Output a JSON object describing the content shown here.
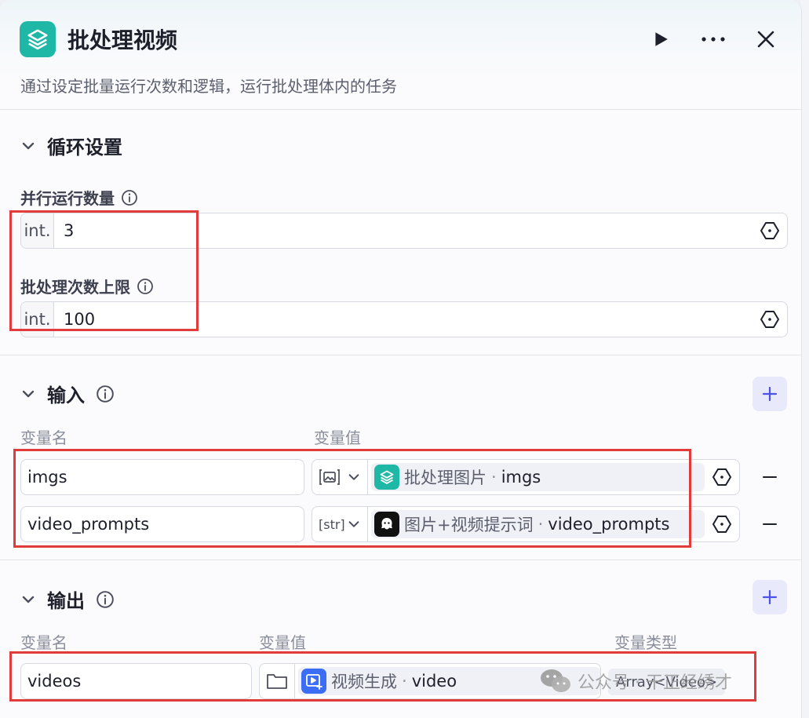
{
  "header": {
    "title": "批处理视频",
    "description": "通过设定批量运行次数和逻辑，运行批处理体内的任务"
  },
  "loop": {
    "section_title": "循环设置",
    "parallel_label": "并行运行数量",
    "parallel_prefix": "int.",
    "parallel_value": "3",
    "limit_label": "批处理次数上限",
    "limit_prefix": "int.",
    "limit_value": "100"
  },
  "input": {
    "section_title": "输入",
    "col_name": "变量名",
    "col_value": "变量值",
    "rows": [
      {
        "name": "imgs",
        "type_icon": "image-type-icon",
        "node": "批处理图片",
        "dot": "·",
        "var": "imgs"
      },
      {
        "name": "video_prompts",
        "type_label": "[str]",
        "type_icon": "string-type-icon",
        "node": "图片+视频提示词",
        "dot": "·",
        "var": "video_prompts"
      }
    ]
  },
  "output": {
    "section_title": "输出",
    "col_name": "变量名",
    "col_value": "变量值",
    "col_type": "变量类型",
    "rows": [
      {
        "name": "videos",
        "node": "视频生成",
        "dot": "·",
        "var": "video",
        "var_type": "Array<Video>"
      }
    ]
  },
  "watermark": "公众号 · 干正经绣才",
  "colors": {
    "node_teal": "#1fb7a6",
    "accent": "#4d53e8",
    "highlight_red": "#e23b3b",
    "video_node_blue": "#3b6ef5"
  }
}
